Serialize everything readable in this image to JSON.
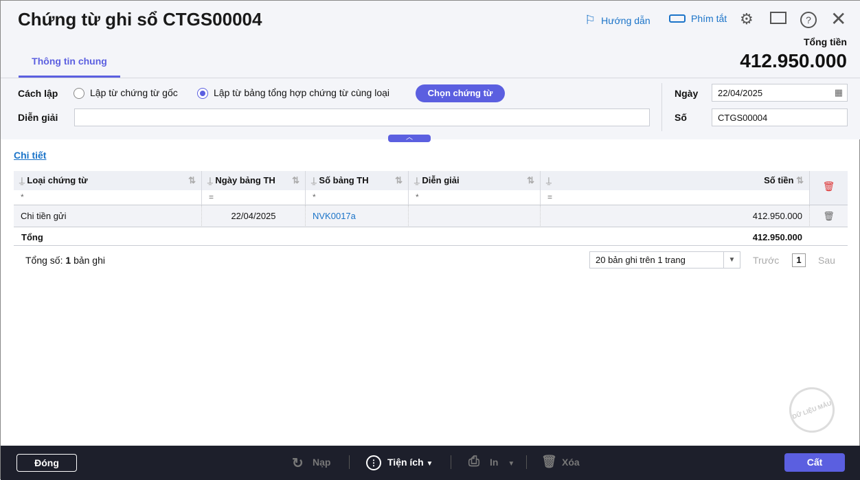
{
  "header": {
    "title": "Chứng từ ghi sổ CTGS00004",
    "guide": "Hướng dẫn",
    "shortcuts": "Phím tắt",
    "total_label": "Tổng tiền",
    "total_value": "412.950.000"
  },
  "tabs": [
    {
      "label": "Thông tin chung"
    }
  ],
  "form": {
    "method_label": "Cách lập",
    "option1": "Lập từ chứng từ gốc",
    "option2": "Lập từ bảng tổng hợp chứng từ cùng loại",
    "choose_btn": "Chọn chứng từ",
    "desc_label": "Diễn giải",
    "desc_value": "",
    "date_label": "Ngày",
    "date_value": "22/04/2025",
    "no_label": "Số",
    "no_value": "CTGS00004"
  },
  "detail": {
    "link": "Chi tiết",
    "columns": [
      "Loại chứng từ",
      "Ngày bảng TH",
      "Số bảng TH",
      "Diễn giải",
      "Số tiền"
    ],
    "filters": [
      "*",
      "=",
      "*",
      "*",
      "="
    ],
    "rows": [
      {
        "type": "Chi tiền gửi",
        "date": "22/04/2025",
        "no": "NVK0017a",
        "desc": "",
        "amount": "412.950.000"
      }
    ],
    "total_label": "Tổng",
    "total_amount": "412.950.000"
  },
  "pager": {
    "total_prefix": "Tổng số:",
    "count": "1",
    "suffix": "bản ghi",
    "page_size": "20 bản ghi trên 1 trang",
    "prev": "Trước",
    "page": "1",
    "next": "Sau"
  },
  "watermark": "DỮ LIỆU MẪU",
  "footer": {
    "close": "Đóng",
    "reload": "Nạp",
    "utilities": "Tiện ích",
    "print": "In",
    "delete": "Xóa",
    "save": "Cất"
  }
}
